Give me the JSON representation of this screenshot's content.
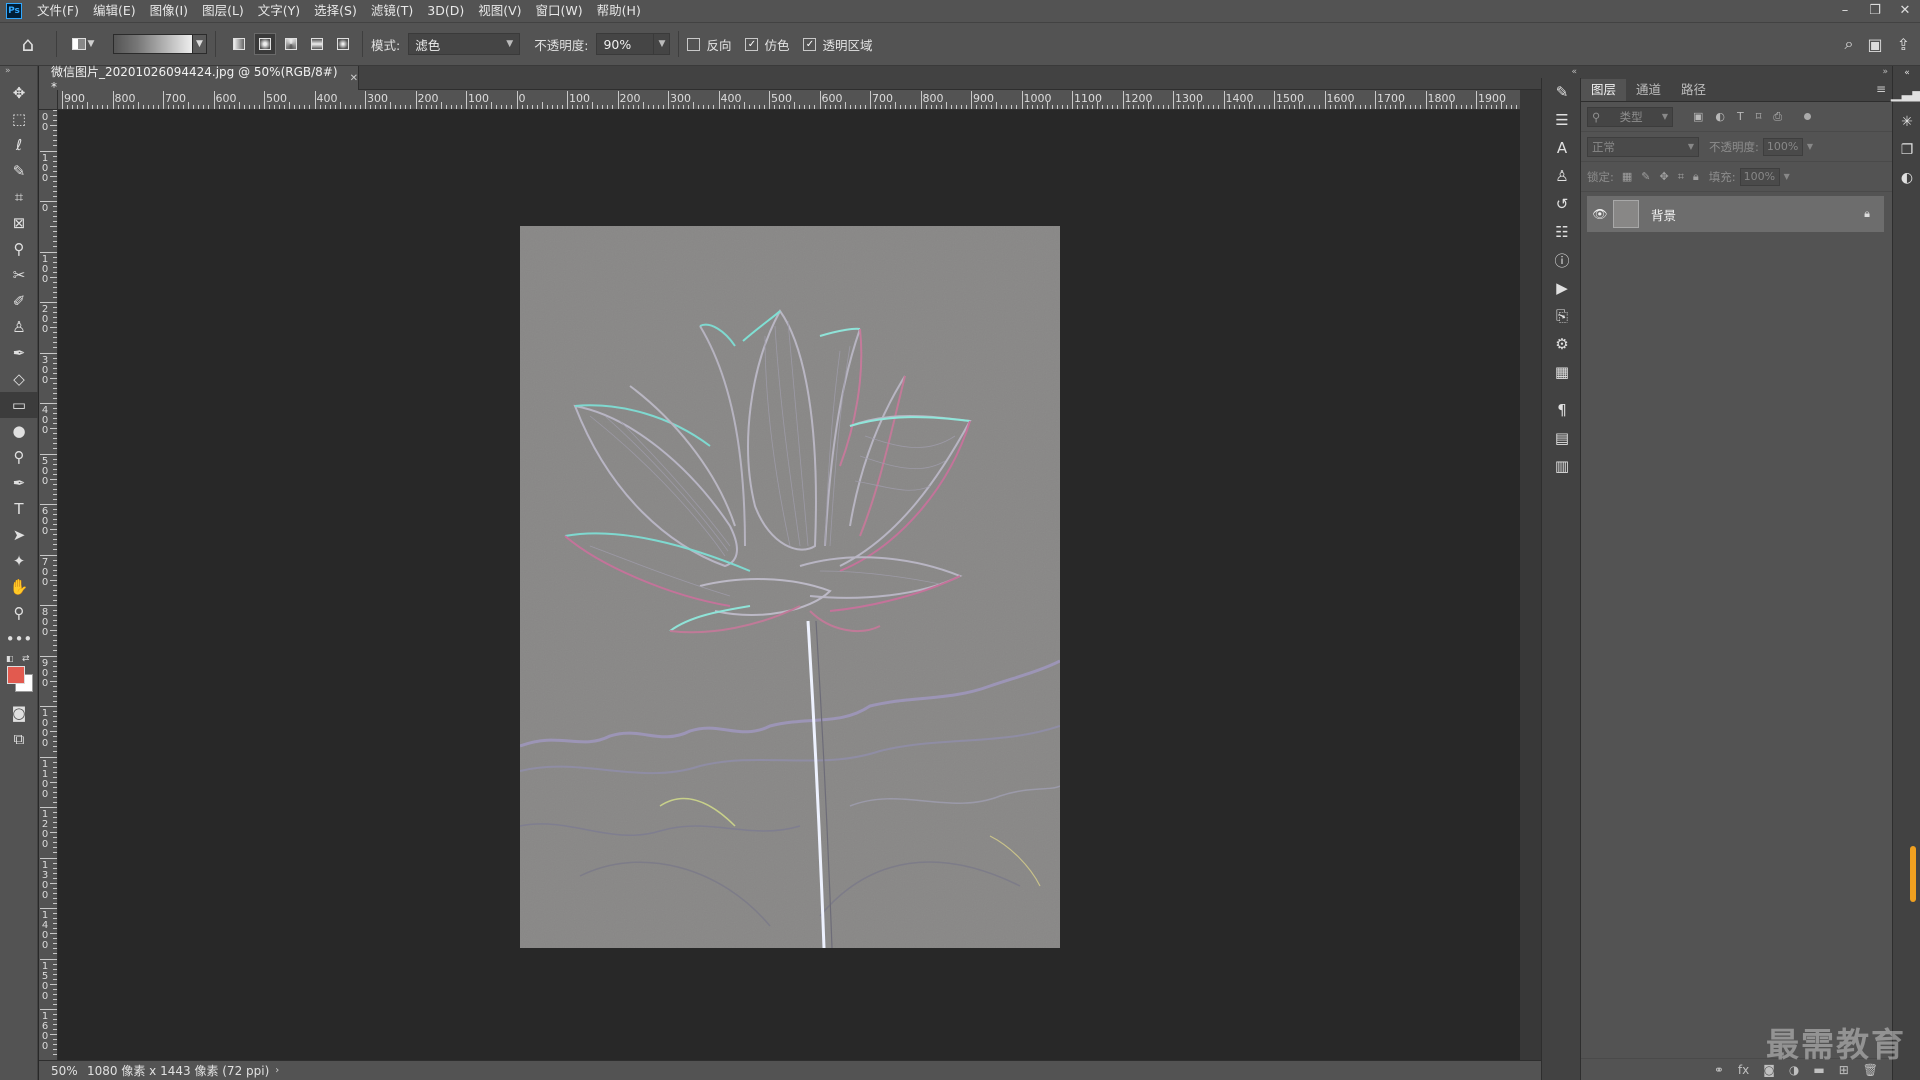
{
  "app": {
    "logo_text": "Ps"
  },
  "menu": [
    "文件(F)",
    "编辑(E)",
    "图像(I)",
    "图层(L)",
    "文字(Y)",
    "选择(S)",
    "滤镜(T)",
    "3D(D)",
    "视图(V)",
    "窗口(W)",
    "帮助(H)"
  ],
  "window_controls": {
    "minimize": "–",
    "restore": "❐",
    "close": "✕"
  },
  "options": {
    "mode_label": "模式:",
    "mode_value": "滤色",
    "opacity_label": "不透明度:",
    "opacity_value": "90%",
    "reverse_label": "反向",
    "reverse_checked": false,
    "dither_label": "仿色",
    "dither_checked": true,
    "transparency_label": "透明区域",
    "transparency_checked": true
  },
  "document": {
    "tab_title": "微信图片_20201026094424.jpg @ 50%(RGB/8#) *",
    "zoom": "50%",
    "info": "1080 像素 x 1443 像素 (72 ppi)"
  },
  "ruler": {
    "h_labels": [
      "900",
      "800",
      "700",
      "600",
      "500",
      "400",
      "300",
      "200",
      "100",
      "0",
      "100",
      "200",
      "300",
      "400",
      "500",
      "600",
      "700",
      "800",
      "900",
      "1000",
      "1100",
      "1200",
      "1300",
      "1400",
      "1500",
      "1600",
      "1700",
      "1800",
      "1900"
    ],
    "v_labels": [
      "200",
      "100",
      "0",
      "100",
      "200",
      "300",
      "400",
      "500",
      "600",
      "700",
      "800",
      "900",
      "1000",
      "1100",
      "1200",
      "1300",
      "1400",
      "1500",
      "1600"
    ]
  },
  "tools": [
    "move-icon",
    "marquee-icon",
    "lasso-icon",
    "quick-select-icon",
    "crop-icon",
    "frame-icon",
    "eyedropper-icon",
    "healing-icon",
    "brush-icon",
    "stamp-icon",
    "history-brush-icon",
    "eraser-icon",
    "gradient-icon",
    "blur-icon",
    "dodge-icon",
    "pen-icon",
    "type-icon",
    "path-select-icon",
    "shape-icon",
    "hand-icon",
    "zoom-icon",
    "more-icon"
  ],
  "colors": {
    "foreground": "#e25a4f",
    "background": "#ffffff"
  },
  "layers_panel": {
    "tabs": [
      "图层",
      "通道",
      "路径"
    ],
    "active_tab": "图层",
    "filter_label": "类型",
    "blend_mode": "正常",
    "opacity_label": "不透明度:",
    "opacity_value": "100%",
    "lock_label": "锁定:",
    "fill_label": "填充:",
    "fill_value": "100%",
    "layers": [
      {
        "name": "背景",
        "visible": true,
        "locked": true
      }
    ],
    "footer": [
      "link-icon",
      "fx-icon",
      "mask-icon",
      "adjustment-icon",
      "folder-icon",
      "new-layer-icon",
      "trash-icon"
    ]
  },
  "watermark": "最需教育"
}
